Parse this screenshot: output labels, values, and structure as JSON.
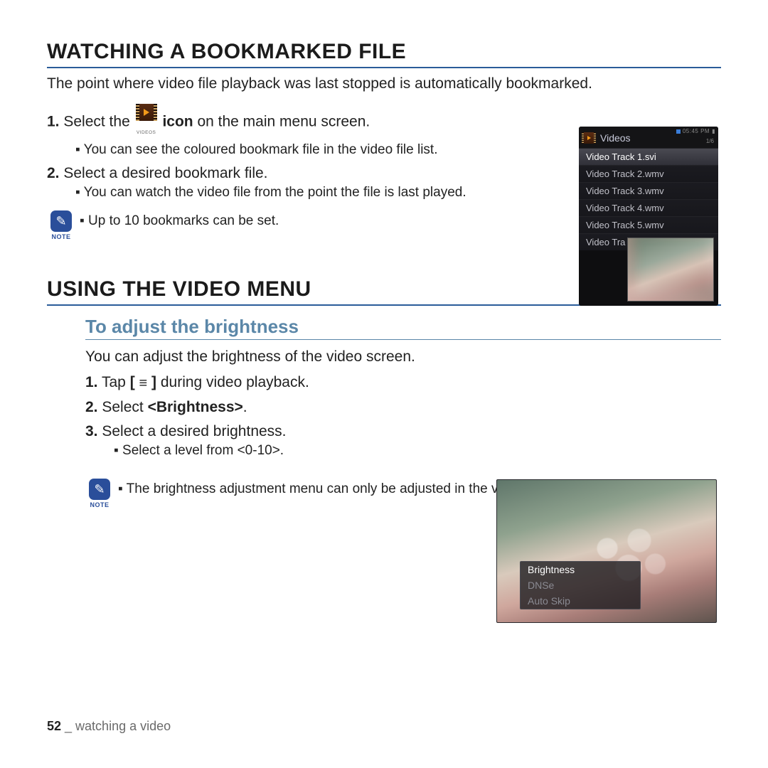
{
  "section1": {
    "title": "WATCHING A BOOKMARKED FILE",
    "intro": "The point where video file playback was last stopped is automatically bookmarked.",
    "step1_pre": "Select the ",
    "step1_post": " on the main menu screen.",
    "step1_icon_bold": "icon",
    "videos_icon_caption": "VIDEOS",
    "bullet1": "You can see the coloured bookmark file in the video file list.",
    "step2": "Select a desired bookmark file.",
    "bullet2": "You can watch the video file from the point the file is last played.",
    "note_label": "NOTE",
    "note_text": "Up to 10 bookmarks can be set."
  },
  "device1": {
    "title": "Videos",
    "status_time": "05:45 PM",
    "count": "1/6",
    "rows": [
      "Video Track 1.svi",
      "Video Track 2.wmv",
      "Video Track 3.wmv",
      "Video Track 4.wmv",
      "Video Track 5.wmv",
      "Video Tra"
    ]
  },
  "section2": {
    "title": "USING THE VIDEO MENU",
    "subtitle": "To adjust the brightness",
    "intro": "You can adjust the brightness of the video screen.",
    "step1_pre": "Tap ",
    "step1_bracket_open": "[ ",
    "step1_bracket_close": " ]",
    "step1_post": " during video playback.",
    "step2_pre": "Select ",
    "step2_bold": "<Brightness>",
    "step2_post": ".",
    "step3": "Select a desired brightness.",
    "bullet3": "Select a level from <0-10>.",
    "note_label": "NOTE",
    "note_text": "The brightness adjustment menu can only be adjusted in the video screen."
  },
  "device2_menu": {
    "items": [
      "Brightness",
      "DNSe",
      "Auto Skip"
    ]
  },
  "footer": {
    "page": "52",
    "sep": " _ ",
    "chapter": "watching a video"
  }
}
